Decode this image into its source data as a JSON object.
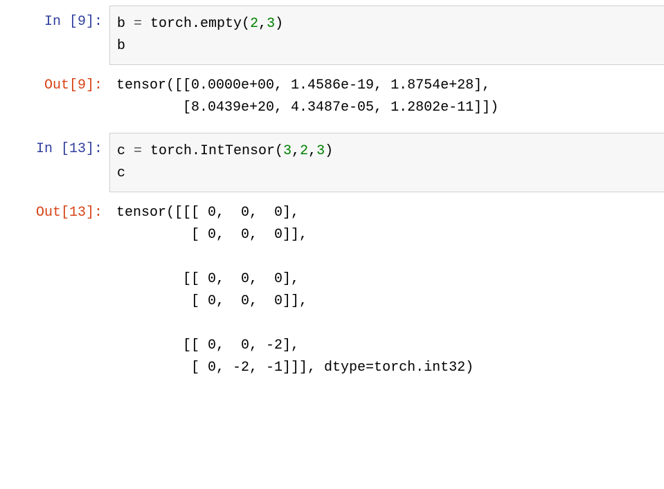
{
  "cells": [
    {
      "type": "in",
      "number": 9,
      "prompt": "In  [9]:",
      "code_lines": [
        [
          {
            "cls": "tk-var",
            "t": "b "
          },
          {
            "cls": "tk-op",
            "t": "= "
          },
          {
            "cls": "tk-func",
            "t": "torch.empty("
          },
          {
            "cls": "tk-num",
            "t": "2"
          },
          {
            "cls": "tk-func",
            "t": ","
          },
          {
            "cls": "tk-num",
            "t": "3"
          },
          {
            "cls": "tk-func",
            "t": ")"
          }
        ],
        [
          {
            "cls": "tk-var",
            "t": "b"
          }
        ]
      ]
    },
    {
      "type": "out",
      "number": 9,
      "prompt": "Out[9]:",
      "output": "tensor([[0.0000e+00, 1.4586e-19, 1.8754e+28],\n        [8.0439e+20, 4.3487e-05, 1.2802e-11]])"
    },
    {
      "type": "in",
      "number": 13,
      "prompt": "In  [13]:",
      "code_lines": [
        [
          {
            "cls": "tk-var",
            "t": "c "
          },
          {
            "cls": "tk-op",
            "t": "= "
          },
          {
            "cls": "tk-func",
            "t": "torch.IntTensor("
          },
          {
            "cls": "tk-num",
            "t": "3"
          },
          {
            "cls": "tk-func",
            "t": ","
          },
          {
            "cls": "tk-num",
            "t": "2"
          },
          {
            "cls": "tk-func",
            "t": ","
          },
          {
            "cls": "tk-num",
            "t": "3"
          },
          {
            "cls": "tk-func",
            "t": ")"
          }
        ],
        [
          {
            "cls": "tk-var",
            "t": "c"
          }
        ]
      ]
    },
    {
      "type": "out",
      "number": 13,
      "prompt": "Out[13]:",
      "output": "tensor([[[ 0,  0,  0],\n         [ 0,  0,  0]],\n\n        [[ 0,  0,  0],\n         [ 0,  0,  0]],\n\n        [[ 0,  0, -2],\n         [ 0, -2, -1]]], dtype=torch.int32)"
    }
  ]
}
